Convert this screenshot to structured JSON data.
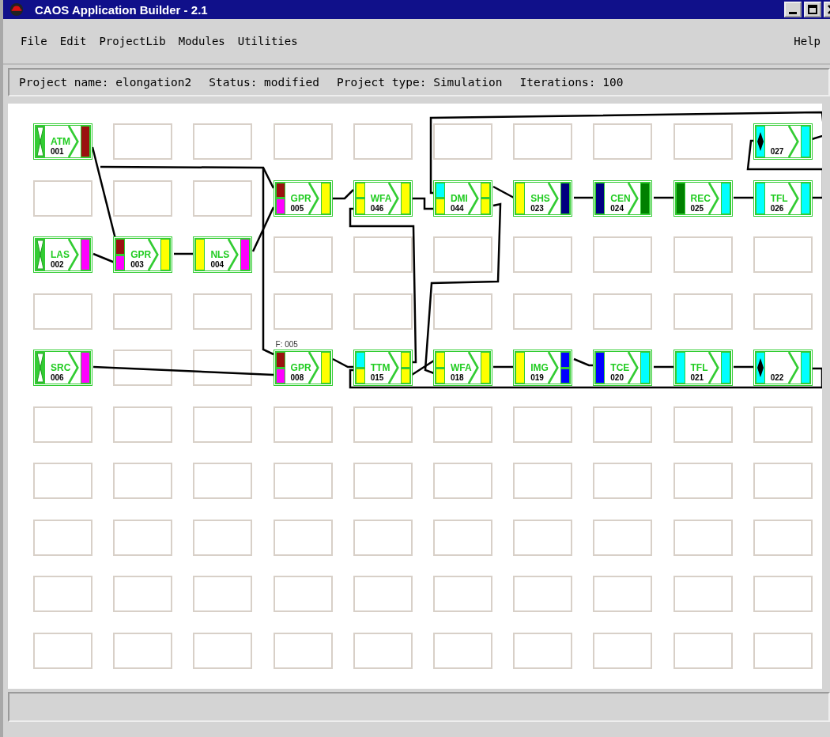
{
  "window": {
    "title": "CAOS Application Builder - 2.1"
  },
  "menu": [
    {
      "label": "File"
    },
    {
      "label": "Edit"
    },
    {
      "label": "ProjectLib"
    },
    {
      "label": "Modules"
    },
    {
      "label": "Utilities"
    }
  ],
  "help_menu": {
    "label": "Help"
  },
  "project_bar": [
    "Project name: elongation2",
    "Status: modified",
    "Project type: Simulation",
    "Iterations: 100"
  ],
  "canvas": {
    "rows": [
      {
        "slots": [
          {
            "kind": "source",
            "label": "ATM",
            "number": "001",
            "outputs": [
              {
                "color": "#9b1010"
              }
            ]
          },
          {
            "kind": "empty"
          },
          {
            "kind": "empty"
          },
          {
            "kind": "empty"
          },
          {
            "kind": "empty"
          },
          {
            "kind": "empty"
          },
          {
            "kind": "empty"
          },
          {
            "kind": "empty"
          },
          {
            "kind": "empty"
          },
          {
            "kind": "junction",
            "number": "027",
            "inputs": [
              {
                "color": "#00ffff"
              }
            ],
            "outputs": [
              {
                "color": "#00ffff"
              }
            ]
          }
        ]
      },
      {
        "slots": [
          {
            "kind": "empty"
          },
          {
            "kind": "empty"
          },
          {
            "kind": "empty"
          },
          {
            "kind": "module",
            "label": "GPR",
            "number": "005",
            "inputs": [
              {
                "color": "#9b1010"
              },
              {
                "color": "#ff00ff"
              }
            ],
            "outputs": [
              {
                "color": "#ffff00"
              }
            ]
          },
          {
            "kind": "module",
            "label": "WFA",
            "number": "046",
            "inputs": [
              {
                "color": "#ffff00"
              },
              {
                "color": "#ffff00"
              }
            ],
            "outputs": [
              {
                "color": "#ffff00"
              }
            ]
          },
          {
            "kind": "module",
            "label": "DMI",
            "number": "044",
            "inputs": [
              {
                "color": "#00ffff"
              },
              {
                "color": "#ffff00"
              }
            ],
            "outputs": [
              {
                "color": "#ffff00"
              },
              {
                "color": "#ffff00"
              }
            ]
          },
          {
            "kind": "module",
            "label": "SHS",
            "number": "023",
            "inputs": [
              {
                "color": "#ffff00"
              }
            ],
            "outputs": [
              {
                "color": "#000080"
              }
            ]
          },
          {
            "kind": "module",
            "label": "CEN",
            "number": "024",
            "inputs": [
              {
                "color": "#000080"
              }
            ],
            "outputs": [
              {
                "color": "#008000"
              }
            ]
          },
          {
            "kind": "module",
            "label": "REC",
            "number": "025",
            "inputs": [
              {
                "color": "#008000"
              }
            ],
            "outputs": [
              {
                "color": "#00ffff"
              }
            ]
          },
          {
            "kind": "module",
            "label": "TFL",
            "number": "026",
            "inputs": [
              {
                "color": "#00ffff"
              }
            ],
            "outputs": [
              {
                "color": "#00ffff"
              }
            ]
          }
        ]
      },
      {
        "slots": [
          {
            "kind": "source",
            "label": "LAS",
            "number": "002",
            "outputs": [
              {
                "color": "#ff00ff"
              }
            ]
          },
          {
            "kind": "module",
            "label": "GPR",
            "number": "003",
            "inputs": [
              {
                "color": "#9b1010"
              },
              {
                "color": "#ff00ff"
              }
            ],
            "outputs": [
              {
                "color": "#ffff00"
              }
            ]
          },
          {
            "kind": "module",
            "label": "NLS",
            "number": "004",
            "inputs": [
              {
                "color": "#ffff00"
              }
            ],
            "outputs": [
              {
                "color": "#ff00ff"
              }
            ]
          },
          {
            "kind": "empty"
          },
          {
            "kind": "empty"
          },
          {
            "kind": "empty"
          },
          {
            "kind": "empty"
          },
          {
            "kind": "empty"
          },
          {
            "kind": "empty"
          },
          {
            "kind": "empty"
          }
        ]
      },
      {
        "slots": [
          {
            "kind": "empty"
          },
          {
            "kind": "empty"
          },
          {
            "kind": "empty"
          },
          {
            "kind": "empty"
          },
          {
            "kind": "empty"
          },
          {
            "kind": "empty"
          },
          {
            "kind": "empty"
          },
          {
            "kind": "empty"
          },
          {
            "kind": "empty"
          },
          {
            "kind": "empty"
          }
        ]
      },
      {
        "slots": [
          {
            "kind": "source",
            "label": "SRC",
            "number": "006",
            "outputs": [
              {
                "color": "#ff00ff"
              }
            ]
          },
          {
            "kind": "empty"
          },
          {
            "kind": "empty"
          },
          {
            "kind": "module",
            "label": "GPR",
            "number": "008",
            "flag": "F: 005",
            "inputs": [
              {
                "color": "#9b1010"
              },
              {
                "color": "#ff00ff"
              }
            ],
            "outputs": [
              {
                "color": "#ffff00"
              }
            ]
          },
          {
            "kind": "module",
            "label": "TTM",
            "number": "015",
            "inputs": [
              {
                "color": "#00ffff"
              },
              {
                "color": "#ffff00"
              }
            ],
            "outputs": [
              {
                "color": "#ffff00"
              },
              {
                "color": "#ffff00"
              }
            ]
          },
          {
            "kind": "module",
            "label": "WFA",
            "number": "018",
            "inputs": [
              {
                "color": "#ffff00"
              },
              {
                "color": "#ffff00"
              }
            ],
            "outputs": [
              {
                "color": "#ffff00"
              }
            ]
          },
          {
            "kind": "module",
            "label": "IMG",
            "number": "019",
            "inputs": [
              {
                "color": "#ffff00"
              }
            ],
            "outputs": [
              {
                "color": "#0000ff"
              },
              {
                "color": "#0000ff"
              }
            ]
          },
          {
            "kind": "module",
            "label": "TCE",
            "number": "020",
            "inputs": [
              {
                "color": "#0000ff"
              }
            ],
            "outputs": [
              {
                "color": "#00ffff"
              }
            ]
          },
          {
            "kind": "module",
            "label": "TFL",
            "number": "021",
            "inputs": [
              {
                "color": "#00ffff"
              }
            ],
            "outputs": [
              {
                "color": "#00ffff"
              }
            ]
          },
          {
            "kind": "junction",
            "number": "022",
            "inputs": [
              {
                "color": "#00ffff"
              }
            ],
            "outputs": [
              {
                "color": "#00ffff"
              }
            ]
          }
        ]
      },
      {
        "slots": [
          {
            "kind": "empty"
          },
          {
            "kind": "empty"
          },
          {
            "kind": "empty"
          },
          {
            "kind": "empty"
          },
          {
            "kind": "empty"
          },
          {
            "kind": "empty"
          },
          {
            "kind": "empty"
          },
          {
            "kind": "empty"
          },
          {
            "kind": "empty"
          },
          {
            "kind": "empty"
          }
        ]
      },
      {
        "slots": [
          {
            "kind": "empty"
          },
          {
            "kind": "empty"
          },
          {
            "kind": "empty"
          },
          {
            "kind": "empty"
          },
          {
            "kind": "empty"
          },
          {
            "kind": "empty"
          },
          {
            "kind": "empty"
          },
          {
            "kind": "empty"
          },
          {
            "kind": "empty"
          },
          {
            "kind": "empty"
          }
        ]
      },
      {
        "slots": [
          {
            "kind": "empty"
          },
          {
            "kind": "empty"
          },
          {
            "kind": "empty"
          },
          {
            "kind": "empty"
          },
          {
            "kind": "empty"
          },
          {
            "kind": "empty"
          },
          {
            "kind": "empty"
          },
          {
            "kind": "empty"
          },
          {
            "kind": "empty"
          },
          {
            "kind": "empty"
          }
        ]
      },
      {
        "slots": [
          {
            "kind": "empty"
          },
          {
            "kind": "empty"
          },
          {
            "kind": "empty"
          },
          {
            "kind": "empty"
          },
          {
            "kind": "empty"
          },
          {
            "kind": "empty"
          },
          {
            "kind": "empty"
          },
          {
            "kind": "empty"
          },
          {
            "kind": "empty"
          },
          {
            "kind": "empty"
          }
        ]
      },
      {
        "slots": [
          {
            "kind": "empty"
          },
          {
            "kind": "empty"
          },
          {
            "kind": "empty"
          },
          {
            "kind": "empty"
          },
          {
            "kind": "empty"
          },
          {
            "kind": "empty"
          },
          {
            "kind": "empty"
          },
          {
            "kind": "empty"
          },
          {
            "kind": "empty"
          },
          {
            "kind": "empty"
          }
        ]
      }
    ]
  }
}
